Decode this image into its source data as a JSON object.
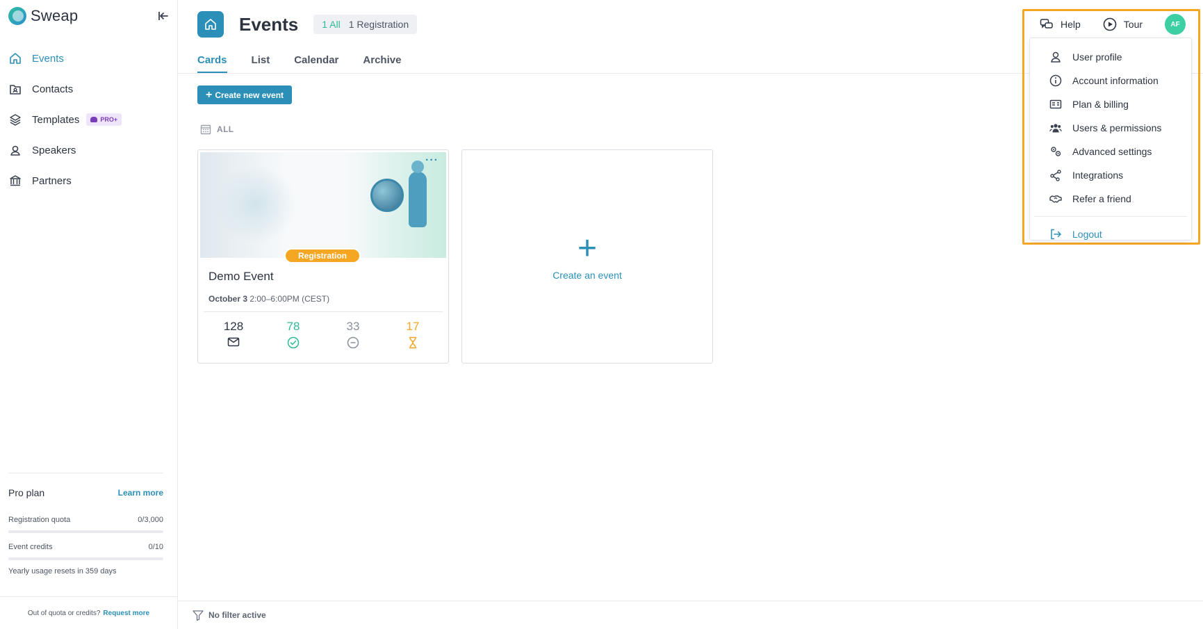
{
  "brand": {
    "name": "Sweap"
  },
  "sidebar": {
    "items": [
      {
        "label": "Events"
      },
      {
        "label": "Contacts"
      },
      {
        "label": "Templates",
        "badge": "PRO+"
      },
      {
        "label": "Speakers"
      },
      {
        "label": "Partners"
      }
    ],
    "plan": {
      "title": "Pro plan",
      "learn_more": "Learn more",
      "registration_label": "Registration quota",
      "registration_value": "0/3,000",
      "registration_fraction": 0,
      "credits_label": "Event credits",
      "credits_value": "0/10",
      "credits_fraction": 0,
      "reset_note": "Yearly usage resets in 359 days"
    },
    "footer": {
      "text": "Out of quota or credits?",
      "link": "Request more"
    }
  },
  "header": {
    "title": "Events",
    "count_all": "1 All",
    "count_registration": "1 Registration",
    "tabs": [
      {
        "label": "Cards"
      },
      {
        "label": "List"
      },
      {
        "label": "Calendar"
      },
      {
        "label": "Archive"
      }
    ]
  },
  "toolbar": {
    "create_label": "Create new event",
    "filter_label": "ALL"
  },
  "event": {
    "name": "Demo Event",
    "status": "Registration",
    "date": "October 3",
    "time": "2:00–6:00PM (CEST)",
    "stats": {
      "invited": "128",
      "accepted": "78",
      "declined": "33",
      "pending": "17"
    }
  },
  "create_card": {
    "label": "Create an event"
  },
  "footer_bar": {
    "text": "No filter active"
  },
  "topbar": {
    "help": "Help",
    "tour": "Tour",
    "avatar_initials": "AF"
  },
  "dropdown": {
    "items": [
      {
        "label": "User profile",
        "icon": "user-icon"
      },
      {
        "label": "Account information",
        "icon": "info-icon"
      },
      {
        "label": "Plan & billing",
        "icon": "billing-card-icon"
      },
      {
        "label": "Users & permissions",
        "icon": "users-icon"
      },
      {
        "label": "Advanced settings",
        "icon": "settings-gears-icon"
      },
      {
        "label": "Integrations",
        "icon": "integrations-icon"
      },
      {
        "label": "Refer a friend",
        "icon": "handshake-icon"
      }
    ],
    "logout": "Logout"
  },
  "colors": {
    "accent": "#2b8fb7",
    "success": "#2fb996",
    "warning": "#f5a623",
    "highlight": "#f5a623",
    "avatar": "#3ccfa4"
  }
}
